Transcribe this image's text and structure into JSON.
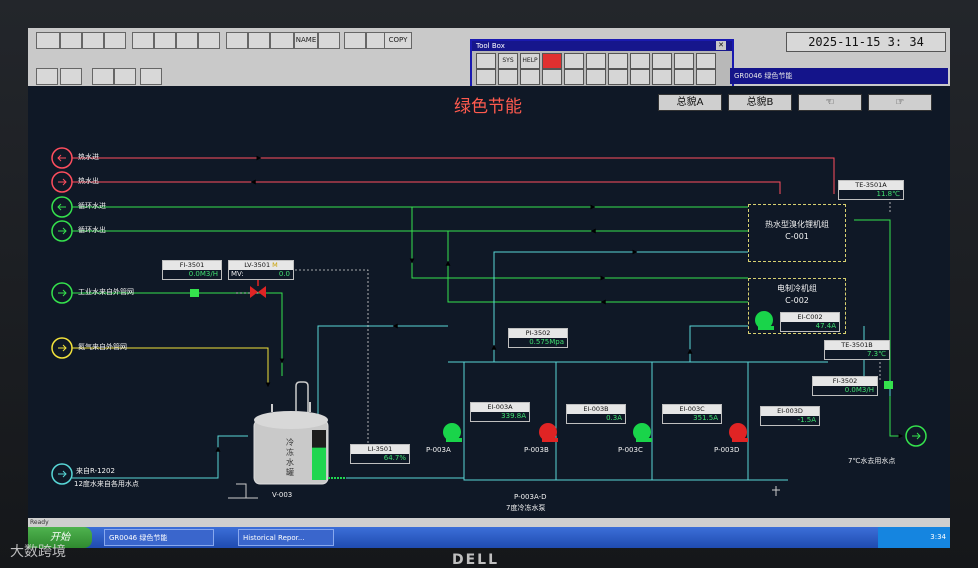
{
  "toolbar": {
    "row1": [
      "",
      "",
      "",
      "",
      "",
      "",
      "",
      "",
      "",
      "",
      "",
      "NAME",
      "",
      "",
      "",
      "COPY"
    ],
    "clock": "2025-11-15  3: 34"
  },
  "toolbox": {
    "title": "Tool Box",
    "row1": [
      "",
      "SYS",
      "HELP",
      "",
      "",
      "",
      "",
      "",
      "",
      "",
      ""
    ],
    "row2": [
      "",
      "",
      "",
      "",
      "",
      "",
      "",
      "",
      "",
      "",
      ""
    ]
  },
  "window_title": "GR0046 绿色节能",
  "page_title": "绿色节能",
  "nav": [
    "总貌A",
    "总貌B",
    "",
    ""
  ],
  "lines": {
    "hot_in": "热水进",
    "hot_out": "热水出",
    "circ_in": "循环水进",
    "circ_out": "循环水出",
    "industrial": "工业水来自外管网",
    "nitrogen": "氮气来自外管网",
    "from_r1202": "来自R-1202",
    "water_12": "12度水来自各用水点",
    "water_7": "7℃水去用水点"
  },
  "units": {
    "c001_name": "热水型溴化锂机组",
    "c001_id": "C-001",
    "c002_name": "电制冷机组",
    "c002_id": "C-002",
    "tank_text": "冷冻水罐",
    "tank_id": "V-003",
    "pump_group_id": "P-003A-D",
    "pump_group_desc": "7度冷冻水泵"
  },
  "pumps": [
    {
      "id": "P-003A",
      "state": "running",
      "color": "#19d44a"
    },
    {
      "id": "P-003B",
      "state": "stopped",
      "color": "#e02424"
    },
    {
      "id": "P-003C",
      "state": "running",
      "color": "#19d44a"
    },
    {
      "id": "P-003D",
      "state": "stopped",
      "color": "#e02424"
    }
  ],
  "tags": {
    "fi3501": {
      "name": "FI-3501",
      "value": "0.0M3/H"
    },
    "lv3501": {
      "name": "LV-3501",
      "mode": "M",
      "mv_label": "MV:",
      "value": "0.0"
    },
    "te3501a": {
      "name": "TE-3501A",
      "value": "11.8℃"
    },
    "ei_c002": {
      "name": "EI-C002",
      "value": "47.4A"
    },
    "te3501b": {
      "name": "TE-3501B",
      "value": "7.3℃"
    },
    "pi3502": {
      "name": "PI-3502",
      "value": "0.575Mpa"
    },
    "fi3502": {
      "name": "FI-3502",
      "value": "0.0M3/H"
    },
    "li3501": {
      "name": "LI-3501",
      "value": "64.7%"
    },
    "ei003a": {
      "name": "EI-003A",
      "value": "339.8A"
    },
    "ei003b": {
      "name": "EI-003B",
      "value": "0.3A"
    },
    "ei003c": {
      "name": "EI-003C",
      "value": "351.5A"
    },
    "ei003d": {
      "name": "EI-003D",
      "value": "-1.5A"
    }
  },
  "tank_level": 0.647,
  "taskbar": {
    "ready": "Ready",
    "start": "开始",
    "tasks": [
      "GR0046 绿色节能",
      "Historical Repor..."
    ],
    "tray_time": "3:34"
  },
  "bezel_brand": "DELL",
  "watermark": "大数跨境",
  "colors": {
    "hot": "#ff4e5e",
    "circ": "#35e24d",
    "cold": "#58d6d6",
    "nitrogen": "#f2e23b",
    "background": "#0f1826"
  }
}
